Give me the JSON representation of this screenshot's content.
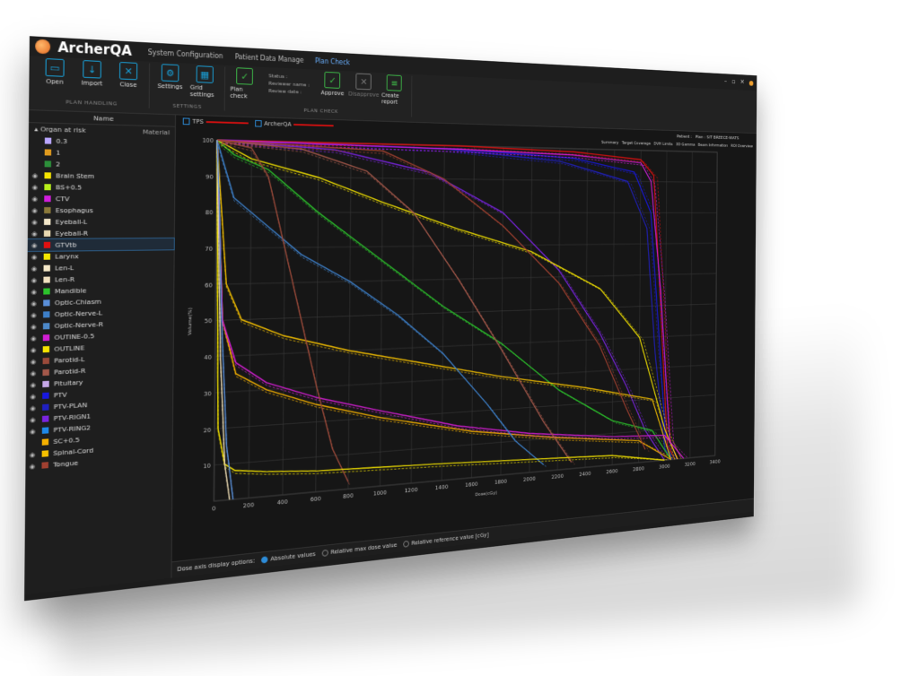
{
  "app": {
    "name": "ArcherQA",
    "menus": [
      "System Configuration",
      "Patient Data Manage",
      "Plan Check"
    ],
    "active_menu": 2
  },
  "ribbon": {
    "plan_handling": {
      "label": "PLAN HANDLING",
      "buttons": [
        "Open",
        "Import",
        "Close"
      ]
    },
    "settings": {
      "label": "SETTINGS",
      "buttons": [
        "Settings",
        "Grid settings"
      ]
    },
    "plan_check": {
      "label": "PLAN CHECK",
      "plan_check_button": "Plan check",
      "status_lines": [
        "Status :",
        "Reviewer name :",
        "Review date :"
      ],
      "approve": "Approve",
      "disapprove": "Disapprove",
      "create_report": "Create report"
    }
  },
  "sidebar": {
    "column_header": "Name",
    "subheader": "Organ at risk",
    "material_label": "Material",
    "organs": [
      {
        "name": "0.3",
        "color": "#b9a6ff",
        "eye": false
      },
      {
        "name": "1",
        "color": "#e09a1e",
        "eye": false
      },
      {
        "name": "2",
        "color": "#2c8f3a",
        "eye": false
      },
      {
        "name": "Brain Stem",
        "color": "#f5e400",
        "eye": true
      },
      {
        "name": "BS+0.5",
        "color": "#b7ee1a",
        "eye": true
      },
      {
        "name": "CTV",
        "color": "#d21edc",
        "eye": true
      },
      {
        "name": "Esophagus",
        "color": "#8b7a3a",
        "eye": true
      },
      {
        "name": "Eyeball-L",
        "color": "#f2e6c8",
        "eye": true
      },
      {
        "name": "Eyeball-R",
        "color": "#e8d8b0",
        "eye": true
      },
      {
        "name": "GTVtb",
        "color": "#e01010",
        "eye": true,
        "selected": true
      },
      {
        "name": "Larynx",
        "color": "#f2e600",
        "eye": true
      },
      {
        "name": "Len-L",
        "color": "#f4e8c8",
        "eye": true
      },
      {
        "name": "Len-R",
        "color": "#f0e0c0",
        "eye": true
      },
      {
        "name": "Mandible",
        "color": "#2cc22c",
        "eye": true
      },
      {
        "name": "Optic-Chiasm",
        "color": "#5a8fd8",
        "eye": true
      },
      {
        "name": "Optic-Nerve-L",
        "color": "#3d7fc8",
        "eye": true
      },
      {
        "name": "Optic-Nerve-R",
        "color": "#4c88c8",
        "eye": true
      },
      {
        "name": "OUTINE-0.5",
        "color": "#d21ed2",
        "eye": true
      },
      {
        "name": "OUTLINE",
        "color": "#f5e400",
        "eye": true
      },
      {
        "name": "Parotid-L",
        "color": "#9a4a3a",
        "eye": true
      },
      {
        "name": "Parotid-R",
        "color": "#a4584a",
        "eye": true
      },
      {
        "name": "Pituitary",
        "color": "#c6a8e8",
        "eye": true
      },
      {
        "name": "PTV",
        "color": "#1818e0",
        "eye": true
      },
      {
        "name": "PTV-PLAN",
        "color": "#2020c0",
        "eye": true
      },
      {
        "name": "PTV-RIGN1",
        "color": "#7a24e0",
        "eye": true
      },
      {
        "name": "PTV-RING2",
        "color": "#1e88e8",
        "eye": true
      },
      {
        "name": "SC+0.5",
        "color": "#f5b000",
        "eye": false
      },
      {
        "name": "Spinal-Cord",
        "color": "#f5c000",
        "eye": true
      },
      {
        "name": "Tongue",
        "color": "#a04030",
        "eye": true
      }
    ]
  },
  "view": {
    "legend": [
      {
        "label": "TPS",
        "color": "#d01010"
      },
      {
        "label": "ArcherQA",
        "color": "#d01010"
      }
    ],
    "patient_label": "Patient :",
    "plan_label": "Plan :",
    "plan_value": "SIT BREECE-WATS",
    "right_tabs": [
      "Summary",
      "Target Coverage",
      "DVH Limits",
      "3D Gamma",
      "Beam Information",
      "ROI Overview"
    ]
  },
  "footer": {
    "label": "Dose axis display options:",
    "options": [
      "Absolute values",
      "Relative max dose value",
      "Relative reference value [cGy]"
    ],
    "selected": 0
  },
  "chart_data": {
    "type": "line",
    "title": "",
    "xlabel": "Dose(cGy)",
    "ylabel": "Volume(%)",
    "xlim": [
      0,
      3400
    ],
    "ylim": [
      0,
      100
    ],
    "xticks": [
      0,
      200,
      400,
      600,
      800,
      1000,
      1200,
      1400,
      1600,
      1800,
      2000,
      2200,
      2400,
      2600,
      2800,
      3000,
      3200,
      3400
    ],
    "yticks": [
      10,
      20,
      30,
      40,
      50,
      60,
      70,
      80,
      90,
      100
    ],
    "grid": true,
    "series": [
      {
        "color": "#e01010",
        "x": [
          0,
          1500,
          2300,
          2800,
          2900,
          2960,
          3020,
          3080
        ],
        "y": [
          100,
          100,
          99,
          97,
          92,
          50,
          5,
          0
        ]
      },
      {
        "color": "#1818e0",
        "x": [
          0,
          1500,
          2300,
          2750,
          2880,
          2950,
          3010,
          3060
        ],
        "y": [
          100,
          99,
          97,
          93,
          80,
          40,
          5,
          0
        ]
      },
      {
        "color": "#2020c0",
        "x": [
          0,
          1400,
          2200,
          2700,
          2850,
          2920,
          3000,
          3050
        ],
        "y": [
          100,
          99,
          96,
          90,
          75,
          35,
          4,
          0
        ]
      },
      {
        "color": "#d21edc",
        "x": [
          0,
          1500,
          2300,
          2800,
          2880,
          2960,
          3040,
          3100
        ],
        "y": [
          100,
          99,
          98,
          96,
          90,
          55,
          6,
          0
        ]
      },
      {
        "color": "#7a24e0",
        "x": [
          0,
          700,
          1300,
          1800,
          2200,
          2500,
          2700,
          2850,
          3000
        ],
        "y": [
          100,
          98,
          92,
          80,
          62,
          42,
          25,
          10,
          0
        ]
      },
      {
        "color": "#2cc22c",
        "x": [
          0,
          100,
          300,
          600,
          1000,
          1400,
          1800,
          2200,
          2600,
          2900,
          3050
        ],
        "y": [
          100,
          96,
          92,
          80,
          66,
          52,
          40,
          25,
          14,
          10,
          0
        ]
      },
      {
        "color": "#f5e400",
        "x": [
          0,
          200,
          600,
          1000,
          1500,
          2000,
          2500,
          2800,
          3000,
          3100
        ],
        "y": [
          100,
          95,
          90,
          83,
          75,
          68,
          56,
          40,
          10,
          0
        ]
      },
      {
        "color": "#f5c000",
        "x": [
          0,
          60,
          150,
          400,
          800,
          1200,
          1800,
          2400,
          2900,
          3050
        ],
        "y": [
          100,
          60,
          50,
          45,
          40,
          36,
          30,
          25,
          20,
          0
        ]
      },
      {
        "color": "#f5b000",
        "x": [
          0,
          40,
          120,
          300,
          600,
          1000,
          1600,
          2200,
          2800,
          3050
        ],
        "y": [
          100,
          50,
          35,
          30,
          25,
          20,
          14,
          10,
          7,
          0
        ]
      },
      {
        "color": "#d21ed2",
        "x": [
          0,
          40,
          120,
          300,
          600,
          1000,
          1500,
          2000,
          2600,
          3000,
          3150
        ],
        "y": [
          100,
          50,
          38,
          32,
          27,
          22,
          16,
          12,
          9,
          8,
          0
        ]
      },
      {
        "color": "#3d7fc8",
        "x": [
          0,
          100,
          300,
          500,
          800,
          1100,
          1400,
          1700,
          1900,
          2100
        ],
        "y": [
          100,
          84,
          76,
          68,
          60,
          50,
          38,
          22,
          10,
          2
        ]
      },
      {
        "color": "#9a4a3a",
        "x": [
          0,
          200,
          300,
          400,
          500,
          600,
          700,
          800
        ],
        "y": [
          100,
          98,
          90,
          70,
          50,
          30,
          12,
          2
        ]
      },
      {
        "color": "#a4584a",
        "x": [
          0,
          500,
          900,
          1200,
          1500,
          1800,
          2100,
          2300
        ],
        "y": [
          100,
          98,
          92,
          80,
          60,
          38,
          15,
          2
        ]
      },
      {
        "color": "#a04030",
        "x": [
          0,
          1000,
          1400,
          1800,
          2200,
          2500,
          2700,
          2850
        ],
        "y": [
          100,
          98,
          90,
          76,
          58,
          38,
          18,
          4
        ]
      },
      {
        "color": "#f5e400",
        "x": [
          0,
          20,
          60,
          120,
          300,
          600,
          1000,
          1400,
          2000,
          2600,
          3000
        ],
        "y": [
          100,
          20,
          10,
          8,
          7,
          6,
          5.5,
          5,
          4,
          3,
          0
        ]
      },
      {
        "color": "#e8d8b0",
        "x": [
          0,
          10,
          30,
          60,
          90
        ],
        "y": [
          100,
          80,
          40,
          10,
          0
        ]
      },
      {
        "color": "#5a8fd8",
        "x": [
          0,
          15,
          35,
          70,
          110
        ],
        "y": [
          100,
          85,
          50,
          15,
          0
        ]
      }
    ]
  }
}
